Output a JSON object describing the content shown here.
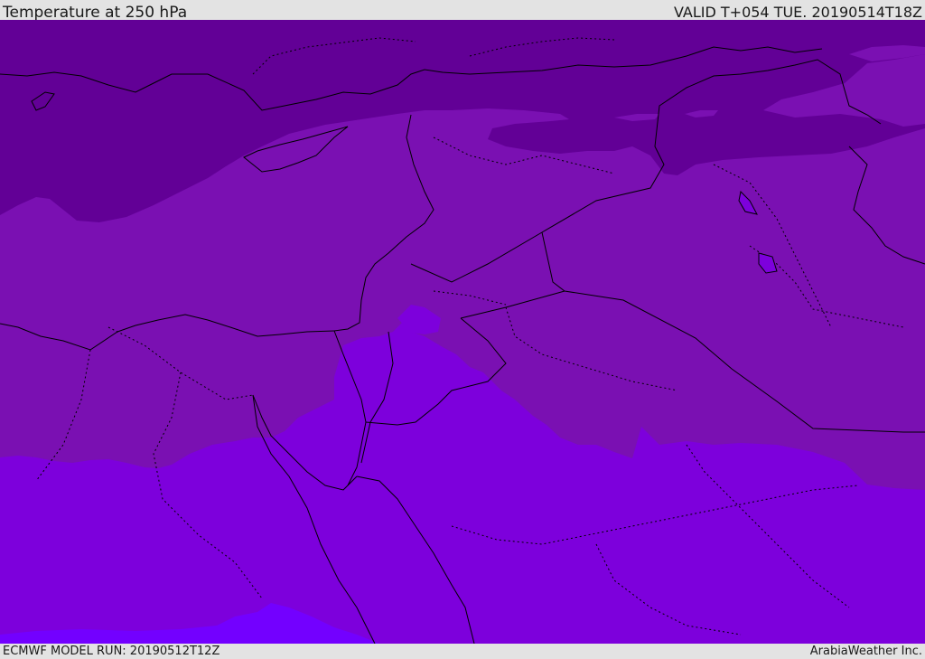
{
  "header": {
    "title": "Temperature at 250 hPa",
    "valid": "VALID T+054 TUE. 20190514T18Z"
  },
  "footer": {
    "model_run": "ECMWF MODEL RUN: 20190512T12Z",
    "credit": "ArabiaWeather Inc."
  },
  "map": {
    "colors": {
      "coldest": "#620096",
      "cold": "#7a10b2",
      "mid": "#7d00dc",
      "warm": "#7300ff",
      "borders": "#000000"
    }
  }
}
